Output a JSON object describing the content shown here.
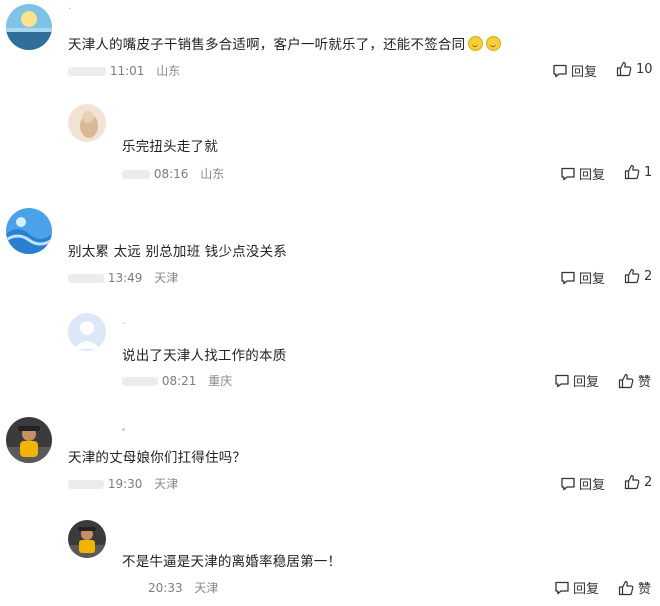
{
  "comments": [
    {
      "level": "top",
      "username": "·",
      "text": "天津人的嘴皮子干销售多合适啊，客户一听就乐了，还能不签合同",
      "emoji_count": 2,
      "time": "11:01",
      "location": "山东",
      "reply_label": "回复",
      "like_count": "10"
    },
    {
      "level": "reply",
      "username": "",
      "text": "乐完扭头走了就",
      "time": "08:16",
      "location": "山东",
      "reply_label": "回复",
      "like_count": "1"
    },
    {
      "level": "top",
      "username": "",
      "text": "别太累 太远 别总加班 钱少点没关系",
      "time": "13:49",
      "location": "天津",
      "reply_label": "回复",
      "like_count": "2"
    },
    {
      "level": "reply",
      "username": "·",
      "text": "说出了天津人找工作的本质",
      "time": "08:21",
      "location": "重庆",
      "reply_label": "回复",
      "like_count": "赞"
    },
    {
      "level": "top",
      "username": "",
      "text": "天津的丈母娘你们扛得住吗？",
      "time": "19:30",
      "location": "天津",
      "reply_label": "回复",
      "like_count": "2"
    },
    {
      "level": "reply",
      "username": "",
      "text": "不是牛逼是天津的离婚率稳居第一！",
      "time": "20:33",
      "location": "天津",
      "reply_label": "回复",
      "like_count": "赞"
    }
  ],
  "icons": {
    "reply": "comment-bubble-icon",
    "like": "thumbs-up-icon",
    "emoji": "smile-emoji-icon"
  },
  "colors": {
    "text": "#222222",
    "meta": "#9a9a9a",
    "background": "#ffffff"
  }
}
